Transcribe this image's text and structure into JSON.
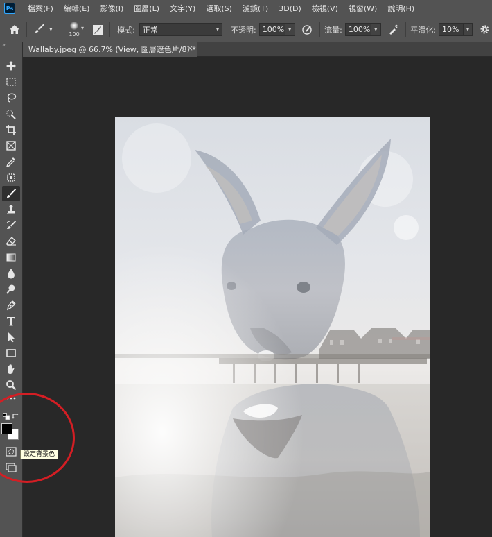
{
  "app": {
    "logo": "Ps"
  },
  "menu": [
    "檔案(F)",
    "編輯(E)",
    "影像(I)",
    "圖層(L)",
    "文字(Y)",
    "選取(S)",
    "濾鏡(T)",
    "3D(D)",
    "檢視(V)",
    "視窗(W)",
    "說明(H)"
  ],
  "options": {
    "brush_size": "100",
    "mode_label": "模式:",
    "mode_value": "正常",
    "opacity_label": "不透明:",
    "opacity_value": "100%",
    "flow_label": "流量:",
    "flow_value": "100%",
    "smoothing_label": "平滑化:",
    "smoothing_value": "10%"
  },
  "document_tab": {
    "title": "Wallaby.jpeg @ 66.7% (View, 圖層遮色片/8) *",
    "close": "×"
  },
  "tooltip": "設定背景色",
  "colors": {
    "foreground": "#000000",
    "background": "#ffffff",
    "annotation": "#d41e24",
    "ps_accent": "#31a8ff"
  },
  "tools": [
    "move-tool",
    "marquee-tool",
    "lasso-tool",
    "quick-selection-tool",
    "crop-tool",
    "frame-tool",
    "eyedropper-tool",
    "healing-brush-tool",
    "brush-tool",
    "clone-stamp-tool",
    "history-brush-tool",
    "eraser-tool",
    "gradient-tool",
    "blur-tool",
    "dodge-tool",
    "pen-tool",
    "type-tool",
    "path-selection-tool",
    "rectangle-tool",
    "hand-tool",
    "zoom-tool",
    "more-tools"
  ]
}
